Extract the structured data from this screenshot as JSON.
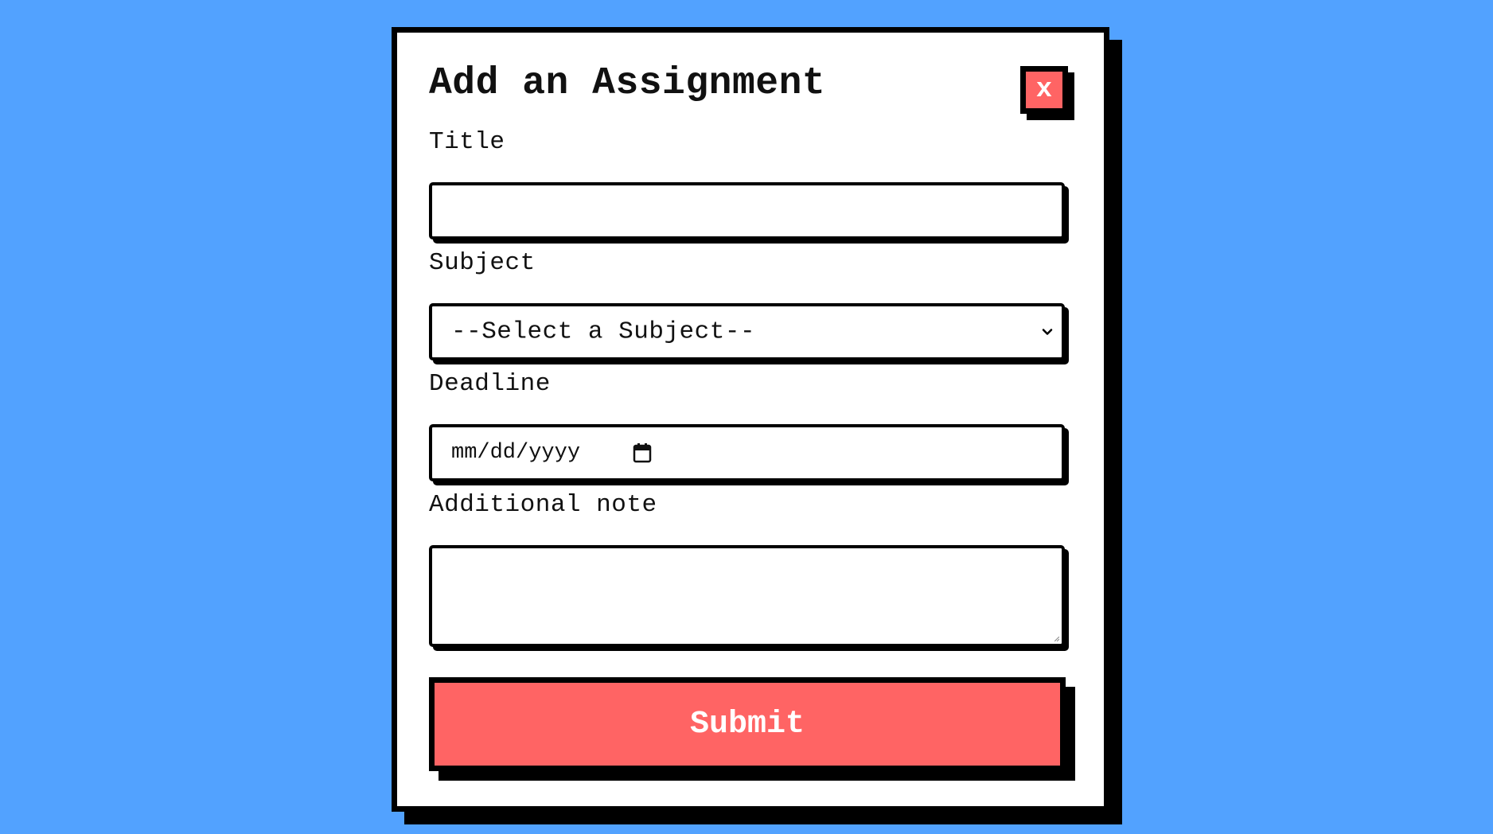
{
  "modal": {
    "title": "Add an Assignment",
    "close_label": "x",
    "close_icon": "close-icon",
    "accent_color": "#ff6464",
    "background_color": "#52a2ff"
  },
  "form": {
    "title_label": "Title",
    "title_value": "",
    "subject_label": "Subject",
    "subject_selected": "--Select a Subject--",
    "subject_icon": "chevron-down-icon",
    "deadline_label": "Deadline",
    "deadline_placeholder": "mm/dd/yyyy",
    "deadline_icon": "calendar-icon",
    "note_label": "Additional note",
    "note_value": "",
    "submit_label": "Submit"
  }
}
